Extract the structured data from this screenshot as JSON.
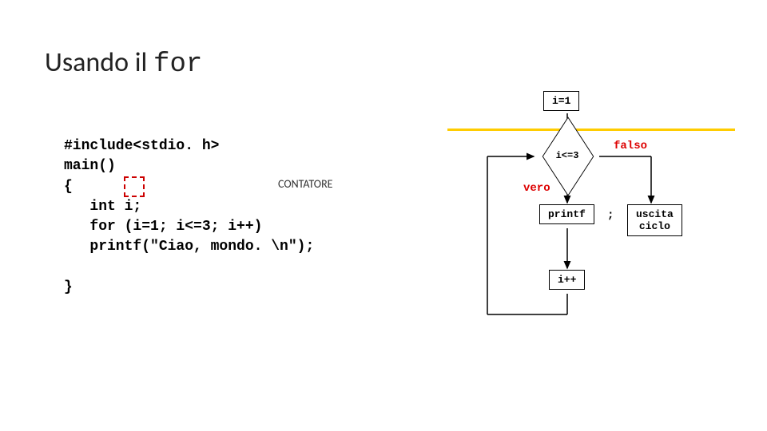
{
  "title": {
    "prefix": "Usando il ",
    "keyword": "for"
  },
  "code": {
    "line1": "#include<stdio. h>",
    "line2": "main()",
    "line3": "{",
    "line4": "   int i;",
    "line5": "   for (i=1; i<=3; i++)",
    "line6": "   printf(\"Ciao, mondo. \\n\");",
    "line7": "}"
  },
  "annotation": "CONTATORE",
  "flowchart": {
    "init": "i=1",
    "cond": "i<=3",
    "true": "vero",
    "false": "falso",
    "body": "printf",
    "inc": "i++",
    "exit1": "uscita",
    "exit2": "ciclo",
    "semicolon": ";"
  }
}
